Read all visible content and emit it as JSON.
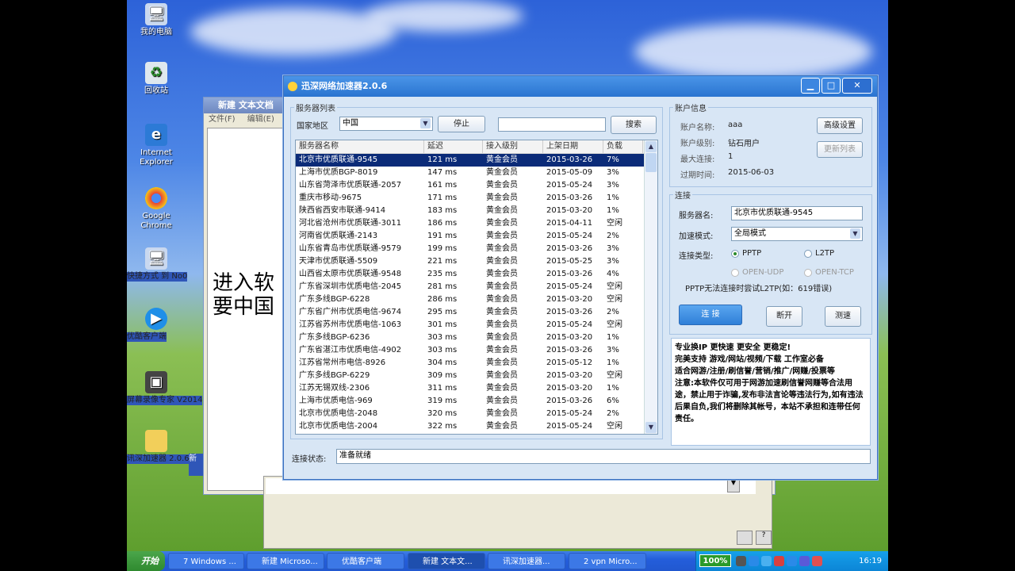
{
  "desktop": {
    "icons": [
      {
        "label": "我的电脑",
        "icon": "computer-icon"
      },
      {
        "label": "回收站",
        "icon": "recycle-bin-icon"
      },
      {
        "label": "Internet Explorer",
        "icon": "ie-icon"
      },
      {
        "label": "Google Chrome",
        "icon": "chrome-icon"
      },
      {
        "label": "快捷方式 到 No0",
        "icon": "shortcut-icon"
      },
      {
        "label": "优酷客户端",
        "icon": "youku-icon"
      },
      {
        "label": "屏幕录像专家 V2014",
        "icon": "recorder-icon"
      },
      {
        "label": "讯深加速器 2.0.6 (1)",
        "icon": "folder-icon"
      }
    ],
    "partial_label": "新"
  },
  "notepad": {
    "title": "新建 文本文档",
    "menu": [
      "文件(F)",
      "编辑(E)"
    ],
    "body_line1": "进入软",
    "body_line2": "要中国"
  },
  "app": {
    "title": "迅深网络加速器2.0.6",
    "server_list": {
      "legend": "服务器列表",
      "region_label": "国家地区",
      "region_value": "中国",
      "stop_label": "停止",
      "search_value": "",
      "search_label": "搜索",
      "columns": [
        "服务器名称",
        "延迟",
        "接入级别",
        "上架日期",
        "负载"
      ],
      "rows": [
        [
          "北京市优质联通-9545",
          "121 ms",
          "黄金会员",
          "2015-03-26",
          "7%"
        ],
        [
          "上海市优质BGP-8019",
          "147 ms",
          "黄金会员",
          "2015-05-09",
          "3%"
        ],
        [
          "山东省菏泽市优质联通-2057",
          "161 ms",
          "黄金会员",
          "2015-05-24",
          "3%"
        ],
        [
          "重庆市移动-9675",
          "171 ms",
          "黄金会员",
          "2015-03-26",
          "1%"
        ],
        [
          "陕西省西安市联通-9414",
          "183 ms",
          "黄金会员",
          "2015-03-20",
          "1%"
        ],
        [
          "河北省沧州市优质联通-3011",
          "186 ms",
          "黄金会员",
          "2015-04-11",
          "空闲"
        ],
        [
          "河南省优质联通-2143",
          "191 ms",
          "黄金会员",
          "2015-05-24",
          "2%"
        ],
        [
          "山东省青岛市优质联通-9579",
          "199 ms",
          "黄金会员",
          "2015-03-26",
          "3%"
        ],
        [
          "天津市优质联通-5509",
          "221 ms",
          "黄金会员",
          "2015-05-25",
          "3%"
        ],
        [
          "山西省太原市优质联通-9548",
          "235 ms",
          "黄金会员",
          "2015-03-26",
          "4%"
        ],
        [
          "广东省深圳市优质电信-2045",
          "281 ms",
          "黄金会员",
          "2015-05-24",
          "空闲"
        ],
        [
          "广东多线BGP-6228",
          "286 ms",
          "黄金会员",
          "2015-03-20",
          "空闲"
        ],
        [
          "广东省广州市优质电信-9674",
          "295 ms",
          "黄金会员",
          "2015-03-26",
          "2%"
        ],
        [
          "江苏省苏州市优质电信-1063",
          "301 ms",
          "黄金会员",
          "2015-05-24",
          "空闲"
        ],
        [
          "广东多线BGP-6236",
          "303 ms",
          "黄金会员",
          "2015-03-20",
          "1%"
        ],
        [
          "广东省湛江市优质电信-4902",
          "303 ms",
          "黄金会员",
          "2015-03-26",
          "3%"
        ],
        [
          "江苏省常州市电信-8926",
          "304 ms",
          "黄金会员",
          "2015-05-12",
          "1%"
        ],
        [
          "广东多线BGP-6229",
          "309 ms",
          "黄金会员",
          "2015-03-20",
          "空闲"
        ],
        [
          "江苏无锡双线-2306",
          "311 ms",
          "黄金会员",
          "2015-03-20",
          "1%"
        ],
        [
          "上海市优质电信-969",
          "319 ms",
          "黄金会员",
          "2015-03-26",
          "6%"
        ],
        [
          "北京市优质电信-2048",
          "320 ms",
          "黄金会员",
          "2015-05-24",
          "2%"
        ],
        [
          "北京市优质电信-2004",
          "322 ms",
          "黄金会员",
          "2015-05-24",
          "空闲"
        ]
      ]
    },
    "account": {
      "legend": "账户信息",
      "name_label": "账户名称:",
      "name_value": "aaa",
      "level_label": "账户级别:",
      "level_value": "钻石用户",
      "max_label": "最大连接:",
      "max_value": "1",
      "expire_label": "过期时间:",
      "expire_value": "2015-06-03",
      "advanced_label": "高级设置",
      "refresh_label": "更新列表"
    },
    "connection": {
      "legend": "连接",
      "server_label": "服务器名:",
      "server_value": "北京市优质联通-9545",
      "mode_label": "加速模式:",
      "mode_value": "全局模式",
      "type_label": "连接类型:",
      "types": [
        "PPTP",
        "L2TP",
        "OPEN-UDP",
        "OPEN-TCP"
      ],
      "hint": "PPTP无法连接时尝试L2TP(如：619错误)",
      "connect_label": "连 接",
      "disconnect_label": "断开",
      "speedtest_label": "测速"
    },
    "notice": "专业换IP 更快速 更安全 更稳定!\n完美支持 游戏/网站/视频/下载 工作室必备\n适合网游/注册/刷信誉/营销/推广/网赚/投票等\n注意:本软件仅可用于网游加速刷信誉网赚等合法用途，禁止用于诈骗,发布非法言论等违法行为,如有违法后果自负,我们将删除其帐号，本站不承担和连带任何责任。",
    "status_label": "连接状态:",
    "status_value": "准备就绪"
  },
  "taskbar": {
    "start": "开始",
    "buttons": [
      "7 Windows ...",
      "新建 Microso...",
      "优酷客户端",
      "新建 文本文...",
      "讯深加速器...",
      "2 vpn Micro..."
    ],
    "battery": "100%",
    "clock": "16:19"
  }
}
